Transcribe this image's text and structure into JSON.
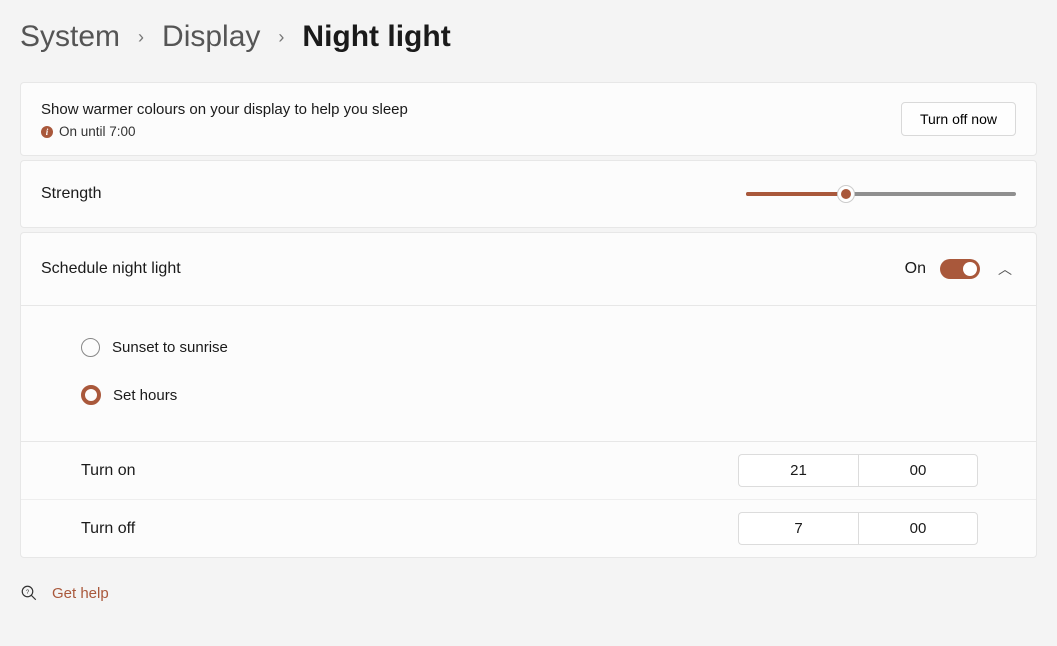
{
  "breadcrumb": {
    "system": "System",
    "display": "Display",
    "current": "Night light"
  },
  "intro": {
    "description": "Show warmer colours on your display to help you sleep",
    "status": "On until 7:00",
    "turn_off_button": "Turn off now"
  },
  "strength": {
    "label": "Strength",
    "value_percent": 37
  },
  "schedule": {
    "label": "Schedule night light",
    "toggle_label": "On",
    "toggle_state": true,
    "options": {
      "sunset": "Sunset to sunrise",
      "set_hours": "Set hours"
    },
    "selected": "set_hours",
    "turn_on": {
      "label": "Turn on",
      "hour": "21",
      "minute": "00"
    },
    "turn_off": {
      "label": "Turn off",
      "hour": "7",
      "minute": "00"
    }
  },
  "help": {
    "label": "Get help"
  }
}
